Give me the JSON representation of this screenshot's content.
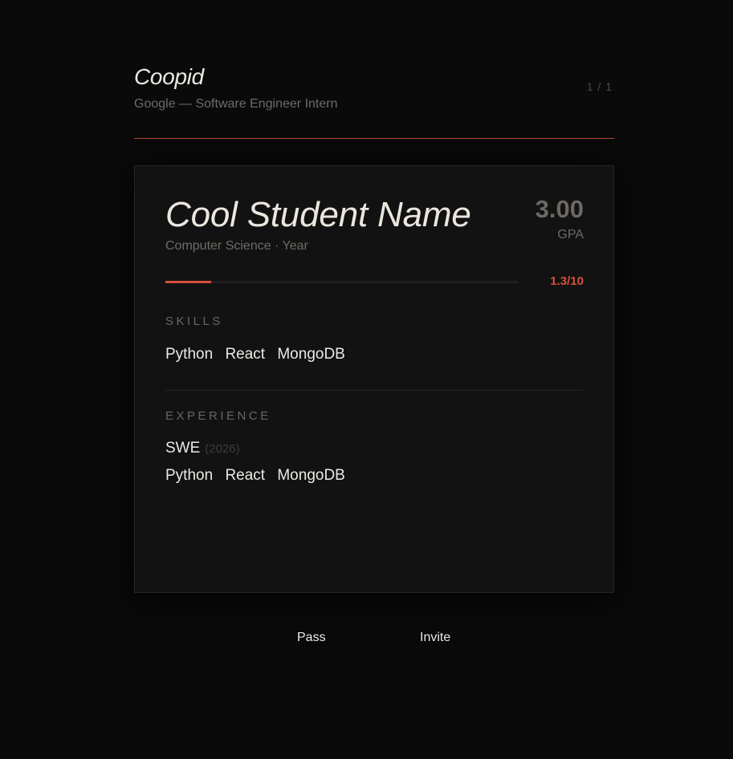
{
  "header": {
    "brand": "Coopid",
    "subtitle": "Google — Software Engineer Intern",
    "pager": "1 / 1"
  },
  "candidate": {
    "name": "Cool Student Name",
    "major": "Computer Science · Year",
    "gpa": "3.00",
    "gpa_label": "GPA",
    "score_text": "1.3/10",
    "score_fraction": 0.13
  },
  "skills": {
    "label": "SKILLS",
    "items": [
      "Python",
      "React",
      "MongoDB"
    ]
  },
  "experience": {
    "label": "EXPERIENCE",
    "title": "SWE",
    "year": "(2026)",
    "items": [
      "Python",
      "React",
      "MongoDB"
    ]
  },
  "actions": {
    "pass_label": "Pass",
    "invite_label": "Invite"
  },
  "colors": {
    "accent": "#d8503c",
    "background": "#0a0a0a",
    "card": "#121212"
  }
}
